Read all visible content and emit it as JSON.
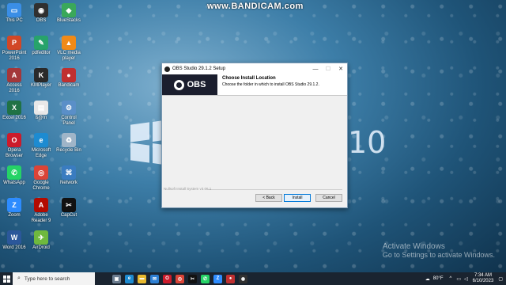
{
  "watermark": "www.BANDICAM.com",
  "desktop": {
    "win_text": "10",
    "activate": {
      "title": "Activate Windows",
      "subtitle": "Go to Settings to activate Windows."
    },
    "icons": [
      {
        "label": "This PC",
        "icon": "computer-icon",
        "color": "#3a8ee6",
        "glyph": "▭"
      },
      {
        "label": "OBS",
        "icon": "obs-icon",
        "color": "#303030",
        "glyph": "◉"
      },
      {
        "label": "BlueStacks",
        "icon": "bluestacks-icon",
        "color": "#3aa85a",
        "glyph": "◆"
      },
      {
        "label": "PowerPoint 2016",
        "icon": "powerpoint-icon",
        "color": "#d24726",
        "glyph": "P"
      },
      {
        "label": "pdfeditor",
        "icon": "pdf-editor-icon",
        "color": "#27a36b",
        "glyph": "✎"
      },
      {
        "label": "VLC media player",
        "icon": "vlc-icon",
        "color": "#f08a18",
        "glyph": "▲"
      },
      {
        "label": "Access 2016",
        "icon": "access-icon",
        "color": "#a4373a",
        "glyph": "A"
      },
      {
        "label": "KMPlayer",
        "icon": "kmplayer-icon",
        "color": "#2a2a2a",
        "glyph": "K"
      },
      {
        "label": "Bandicam",
        "icon": "bandicam-icon",
        "color": "#c03030",
        "glyph": "●"
      },
      {
        "label": "Excel 2016",
        "icon": "excel-icon",
        "color": "#207245",
        "glyph": "X"
      },
      {
        "label": "ß@!n",
        "icon": "document-icon",
        "color": "#e8e8e8",
        "glyph": "▤"
      },
      {
        "label": "Control Panel",
        "icon": "control-panel-icon",
        "color": "#5a8fc8",
        "glyph": "⚙"
      },
      {
        "label": "Opera Browser",
        "icon": "opera-icon",
        "color": "#cc1b2b",
        "glyph": "O"
      },
      {
        "label": "Microsoft Edge",
        "icon": "edge-icon",
        "color": "#1d8bd1",
        "glyph": "e"
      },
      {
        "label": "Recycle Bin",
        "icon": "recycle-bin-icon",
        "color": "#9fb5c8",
        "glyph": "♻"
      },
      {
        "label": "WhatsApp",
        "icon": "whatsapp-icon",
        "color": "#25d366",
        "glyph": "✆"
      },
      {
        "label": "Google Chrome",
        "icon": "chrome-icon",
        "color": "#db4437",
        "glyph": "◎"
      },
      {
        "label": "Network",
        "icon": "network-icon",
        "color": "#3a7cc0",
        "glyph": "⌘"
      },
      {
        "label": "Zoom",
        "icon": "zoom-icon",
        "color": "#2d8cff",
        "glyph": "Z"
      },
      {
        "label": "Adobe Reader 9",
        "icon": "adobe-reader-icon",
        "color": "#b30b00",
        "glyph": "A"
      },
      {
        "label": "CapCut",
        "icon": "capcut-icon",
        "color": "#111111",
        "glyph": "✂"
      },
      {
        "label": "Word 2016",
        "icon": "word-icon",
        "color": "#2b579a",
        "glyph": "W"
      },
      {
        "label": "AirDroid",
        "icon": "airdroid-icon",
        "color": "#6fb93e",
        "glyph": "✈"
      }
    ]
  },
  "dialog": {
    "title": "OBS Studio 29.1.2 Setup",
    "banner_text": "OBS",
    "heading": "Choose Install Location",
    "subheading": "Choose the folder in which to install OBS Studio 29.1.2.",
    "branding": "Nullsoft Install System v3.06.1",
    "buttons": {
      "back": "< Back",
      "install": "Install",
      "cancel": "Cancel"
    },
    "controls": {
      "minimize": "—",
      "maximize": "☐",
      "close": "✕"
    }
  },
  "taskbar": {
    "search_placeholder": "Type here to search",
    "apps": [
      {
        "icon": "task-view-icon",
        "color": "#6b7c8f",
        "glyph": "▣"
      },
      {
        "icon": "edge-icon",
        "color": "#1d8bd1",
        "glyph": "e"
      },
      {
        "icon": "file-explorer-icon",
        "color": "#e8b92e",
        "glyph": "▬"
      },
      {
        "icon": "mail-icon",
        "color": "#2d7fd3",
        "glyph": "✉"
      },
      {
        "icon": "opera-icon",
        "color": "#cc1b2b",
        "glyph": "O"
      },
      {
        "icon": "chrome-icon",
        "color": "#db4437",
        "glyph": "◎"
      },
      {
        "icon": "capcut-icon",
        "color": "#111111",
        "glyph": "✂"
      },
      {
        "icon": "whatsapp-icon",
        "color": "#25d366",
        "glyph": "✆"
      },
      {
        "icon": "zoom-icon",
        "color": "#2d8cff",
        "glyph": "Z"
      },
      {
        "icon": "bandicam-icon",
        "color": "#c03030",
        "glyph": "●"
      },
      {
        "icon": "obs-icon",
        "color": "#303030",
        "glyph": "◉"
      }
    ],
    "weather": "80°F",
    "time": "7:34 AM",
    "date": "6/10/2023"
  }
}
